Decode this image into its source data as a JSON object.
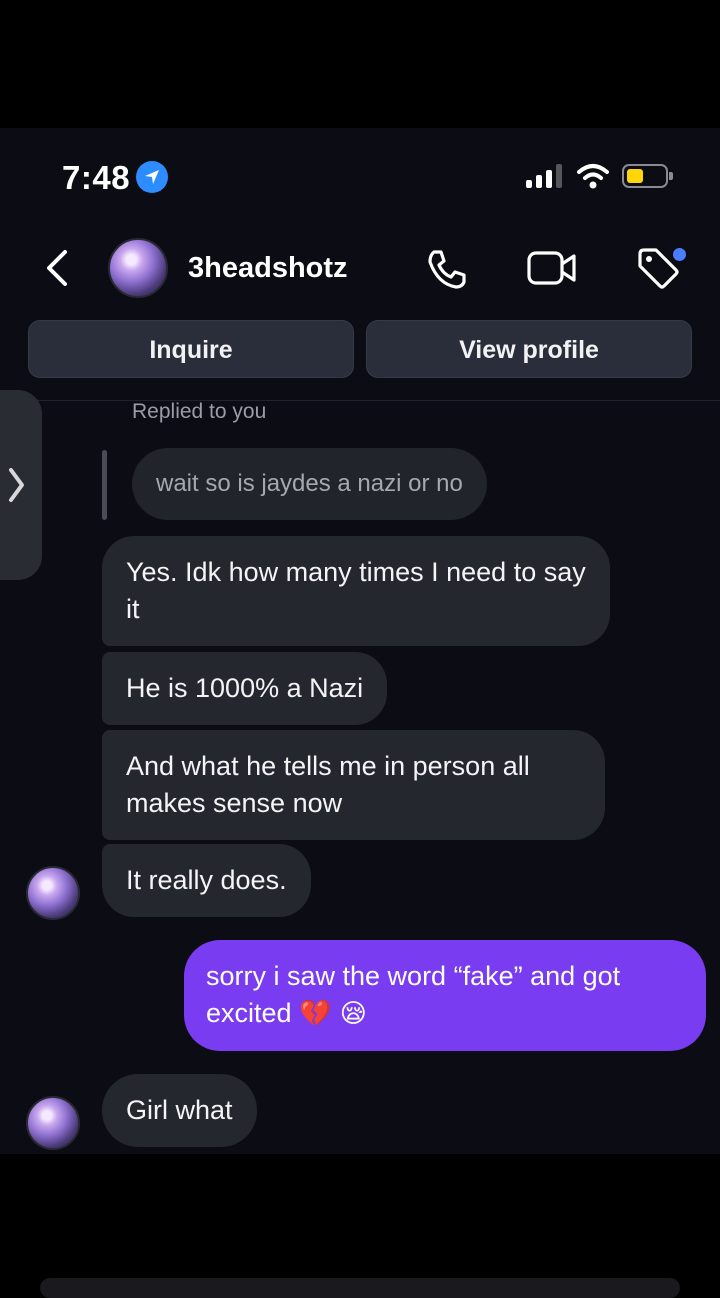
{
  "status_bar": {
    "time": "7:48"
  },
  "header": {
    "username": "3headshotz"
  },
  "actions": {
    "inquire_label": "Inquire",
    "view_profile_label": "View profile"
  },
  "thread": {
    "replied_label": "Replied to you",
    "quoted_message": "wait so is jaydes a nazi or no",
    "messages": [
      {
        "from": "them",
        "text": "Yes. Idk how many times I need to say it"
      },
      {
        "from": "them",
        "text": "He is 1000% a Nazi"
      },
      {
        "from": "them",
        "text": "And what he tells me in person all makes sense now"
      },
      {
        "from": "them",
        "text": "It really does."
      },
      {
        "from": "me",
        "text": "sorry i saw the word “fake” and got excited",
        "emoji": "💔 😪"
      },
      {
        "from": "them",
        "text": "Girl what"
      }
    ]
  },
  "colors": {
    "outgoing_bubble": "#7a3cf0",
    "incoming_bubble": "#25272e",
    "background": "#0b0c14",
    "battery": "#ffd60a",
    "location": "#2d8cff"
  },
  "icons": [
    "location-arrow-icon",
    "signal-icon",
    "wifi-icon",
    "battery-icon",
    "back-chevron-icon",
    "phone-icon",
    "video-camera-icon",
    "tag-icon",
    "chevron-right-icon"
  ]
}
